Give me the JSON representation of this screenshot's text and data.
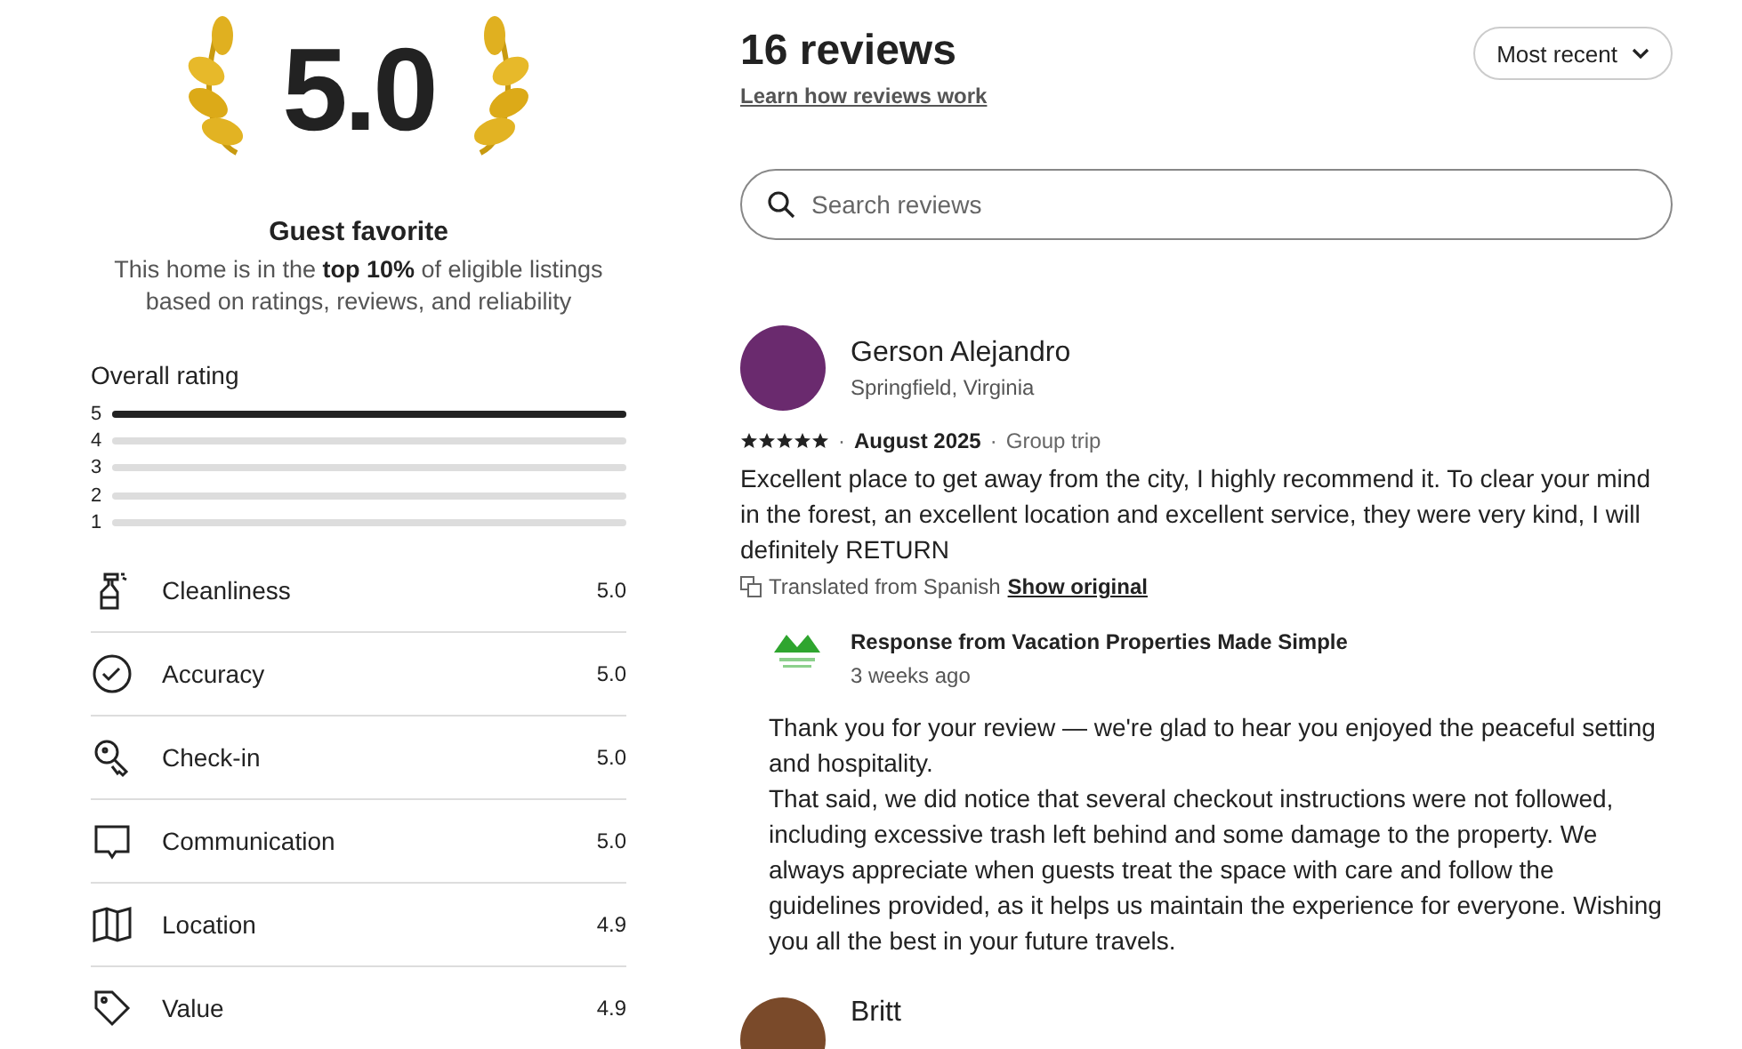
{
  "summary": {
    "score": "5.0",
    "badge": "Guest favorite",
    "description": "This home is in the **top 10%** of eligible listings based on ratings, reviews, and reliability"
  },
  "overall_rating": {
    "title": "Overall rating",
    "bars": [
      {
        "label": "5",
        "level": 1
      },
      {
        "label": "4",
        "level": 0
      },
      {
        "label": "3",
        "level": 0
      },
      {
        "label": "2",
        "level": 0
      },
      {
        "label": "1",
        "level": 0
      }
    ]
  },
  "categories": [
    {
      "kind": "spray",
      "label": "Cleanliness",
      "score": "5.0"
    },
    {
      "kind": "check",
      "label": "Accuracy",
      "score": "5.0"
    },
    {
      "kind": "key",
      "label": "Check-in",
      "score": "5.0"
    },
    {
      "kind": "chat",
      "label": "Communication",
      "score": "5.0"
    },
    {
      "kind": "map",
      "label": "Location",
      "score": "4.9"
    },
    {
      "kind": "tag",
      "label": "Value",
      "score": "4.9"
    }
  ],
  "reviews_header": {
    "title": "16 reviews",
    "link": "Learn how reviews work",
    "sort": "Most recent"
  },
  "search": {
    "placeholder": "Search reviews"
  },
  "reviews": [
    {
      "name": "Gerson Alejandro",
      "location": "Springfield, Virginia",
      "stars": 5,
      "separator": "·",
      "date": "August 2025",
      "trip": "Group trip",
      "text": "Excellent place to get away from the city, I highly recommend it. To clear your mind in the forest, an excellent location and excellent service, they were very kind, I will definitely RETURN",
      "translation": "Translated from Spanish",
      "translation_link": "Show original",
      "response": {
        "title": "Response from Vacation Properties Made Simple",
        "time": "3 weeks ago",
        "paragraphs": [
          "Thank you for your review — we're glad to hear you enjoyed the peaceful setting and hospitality.",
          "That said, we did notice that several checkout instructions were not followed, including excessive trash left behind and some damage to the property. We always appreciate when guests treat the space with care and follow the guidelines provided, as it helps us maintain the experience for everyone. Wishing you all the best in your future travels."
        ]
      }
    },
    {
      "name": "Britt"
    }
  ]
}
